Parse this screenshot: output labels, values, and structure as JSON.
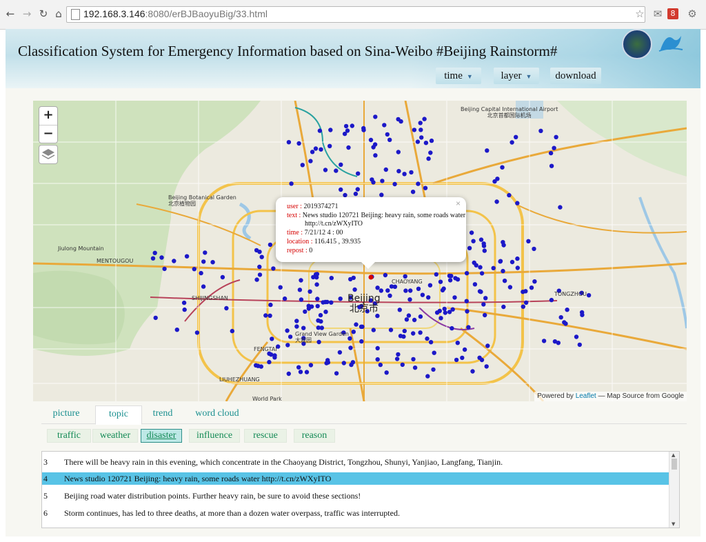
{
  "browser": {
    "url_host": "192.168.3.146",
    "url_rest": ":8080/erBJBaoyuBig/33.html"
  },
  "header": {
    "title": "Classification System for Emergency Information based on Sina-Weibo #Beijing Rainstorm#",
    "menus": [
      "time",
      "layer",
      "download"
    ]
  },
  "map": {
    "zoom_in": "+",
    "zoom_out": "−",
    "labels": {
      "beijing_en": "Beijing",
      "beijing_cn": "北京市",
      "botanical_en": "Beijing Botanical Garden",
      "botanical_cn": "北京植物园",
      "airport_en": "Beijing Capital International Airport",
      "airport_cn": "北京首都国际机场",
      "grandview_en": "Grand View Garden",
      "grandview_cn": "大观园",
      "chaoyang": "CHAOYANG",
      "tongzhou": "TONGZHOU",
      "jiulong": "Jiulong Mountain",
      "mentougou": "MENTOUGOU",
      "fengtai": "FENGTAI",
      "shijingshan": "SHIJINGSHAN",
      "worldpark": "World Park",
      "liuhezhuang": "LIUHEZHUANG"
    },
    "attribution_prefix": "Powered by ",
    "attribution_link": "Leaflet",
    "attribution_suffix": " — Map Source from Google"
  },
  "popup": {
    "user_label": "user :",
    "user": "2019374271",
    "text_label": "text :",
    "text_line1": "News studio 120721 Beijing: heavy rain, some roads water",
    "text_line2": "http://t.cn/zWXyITO",
    "time_label": "time :",
    "time": "7/21/12  4 : 00",
    "location_label": "location :",
    "location": "116.415 , 39.935",
    "repost_label": "repost :",
    "repost": "0",
    "close": "×"
  },
  "tabs": [
    "picture",
    "topic",
    "trend",
    "word cloud"
  ],
  "subtabs": [
    "traffic",
    "weather",
    "disaster",
    "influence",
    "rescue",
    "reason"
  ],
  "list": [
    {
      "num": "3",
      "text": "There will be heavy rain in this evening, which concentrate in the Chaoyang District, Tongzhou, Shunyi, Yanjiao, Langfang, Tianjin."
    },
    {
      "num": "4",
      "text": "News studio 120721 Beijing: heavy rain, some roads water http://t.cn/zWXyITO"
    },
    {
      "num": "5",
      "text": "Beijing road water distribution points. Further heavy rain, be sure to avoid these sections!"
    },
    {
      "num": "6",
      "text": "Storm continues, has led to three deaths, at more than a dozen water overpass, traffic was interrupted."
    }
  ],
  "colors": {
    "accent": "#1a8f8f",
    "highlight_row": "#58c3e6",
    "point": "#1c18c8",
    "popup_key": "#d60000"
  }
}
